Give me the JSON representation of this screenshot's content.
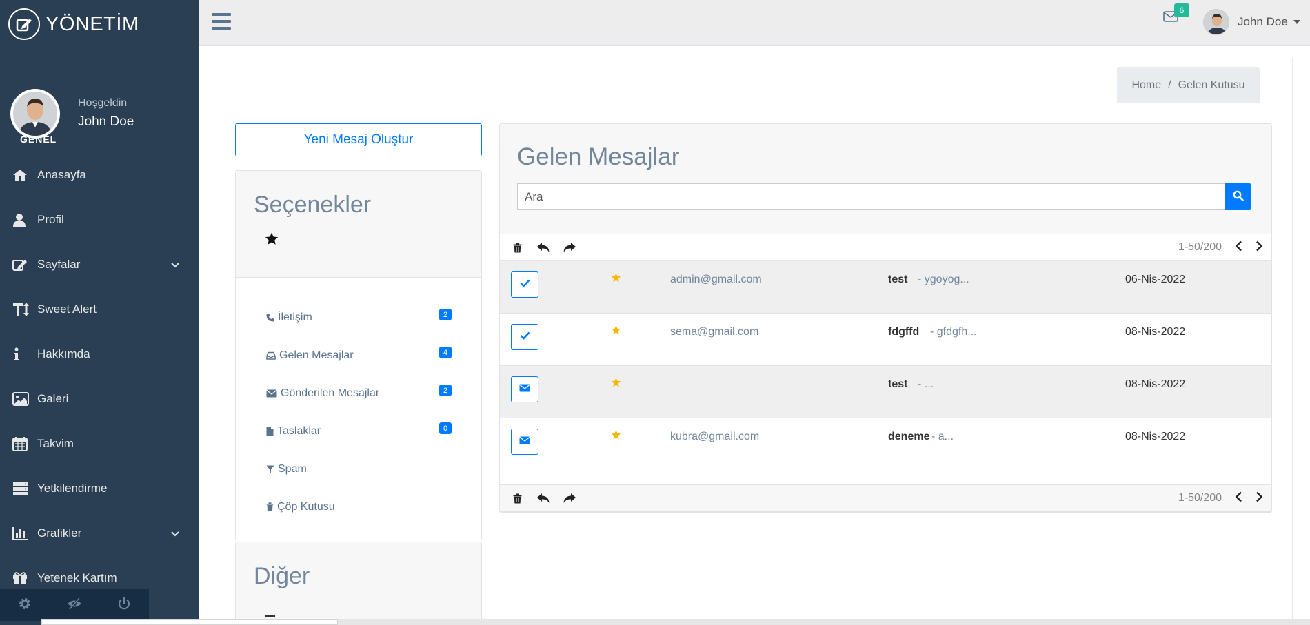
{
  "brand": {
    "title": "YÖNETİM"
  },
  "profile": {
    "welcome": "Hoşgeldin",
    "name": "John Doe"
  },
  "sidebar": {
    "section": "GENEL",
    "items": [
      {
        "label": "Anasayfa",
        "icon": "home-icon",
        "submenu": false
      },
      {
        "label": "Profil",
        "icon": "user-icon",
        "submenu": false
      },
      {
        "label": "Sayfalar",
        "icon": "edit-icon",
        "submenu": true
      },
      {
        "label": "Sweet Alert",
        "icon": "text-height-icon",
        "submenu": false
      },
      {
        "label": "Hakkımda",
        "icon": "info-icon",
        "submenu": false
      },
      {
        "label": "Galeri",
        "icon": "image-icon",
        "submenu": false
      },
      {
        "label": "Takvim",
        "icon": "calendar-icon",
        "submenu": false
      },
      {
        "label": "Yetkilendirme",
        "icon": "server-icon",
        "submenu": false
      },
      {
        "label": "Grafikler",
        "icon": "bar-chart-icon",
        "submenu": true
      },
      {
        "label": "Yetenek Kartım",
        "icon": "gift-icon",
        "submenu": false
      }
    ],
    "footer_icons": [
      "gear-icon",
      "eye-slash-icon",
      "power-icon"
    ]
  },
  "topbar": {
    "notifications": "6",
    "user_name": "John Doe"
  },
  "breadcrumb": {
    "home": "Home",
    "separator": "/",
    "current": "Gelen Kutusu"
  },
  "compose": {
    "label": "Yeni Mesaj Oluştur"
  },
  "options": {
    "title": "Seçenekler",
    "folders": [
      {
        "label": "İletişim",
        "icon": "phone-icon",
        "badge": "2"
      },
      {
        "label": "Gelen Mesajlar",
        "icon": "inbox-icon",
        "badge": "4"
      },
      {
        "label": "Gönderilen Mesajlar",
        "icon": "envelope-icon",
        "badge": "2"
      },
      {
        "label": "Taslaklar",
        "icon": "file-icon",
        "badge": "0"
      },
      {
        "label": "Spam",
        "icon": "filter-icon",
        "badge": null
      },
      {
        "label": "Çöp Kutusu",
        "icon": "trash-icon",
        "badge": null
      }
    ]
  },
  "other": {
    "title": "Diğer"
  },
  "inbox": {
    "title": "Gelen Mesajlar",
    "search_placeholder": "Ara",
    "pager": "1-50/200",
    "messages": [
      {
        "state": "checked",
        "sender": "admin@gmail.com",
        "subject": "test",
        "excerpt": " - ygoyog...",
        "date": "06-Nis-2022"
      },
      {
        "state": "checked",
        "sender": "sema@gmail.com",
        "subject": "fdgffd",
        "excerpt": " - gfdgfh...",
        "date": "08-Nis-2022"
      },
      {
        "state": "unread",
        "sender": "",
        "subject": "test",
        "excerpt": " - ...",
        "date": "08-Nis-2022"
      },
      {
        "state": "unread",
        "sender": "kubra@gmail.com",
        "subject": "deneme",
        "excerpt": " - a...",
        "date": "08-Nis-2022"
      }
    ]
  },
  "colors": {
    "sidebar": "#2a3f54",
    "accent": "#007bff",
    "badge_green": "#26b99a",
    "star": "#f5b800"
  }
}
